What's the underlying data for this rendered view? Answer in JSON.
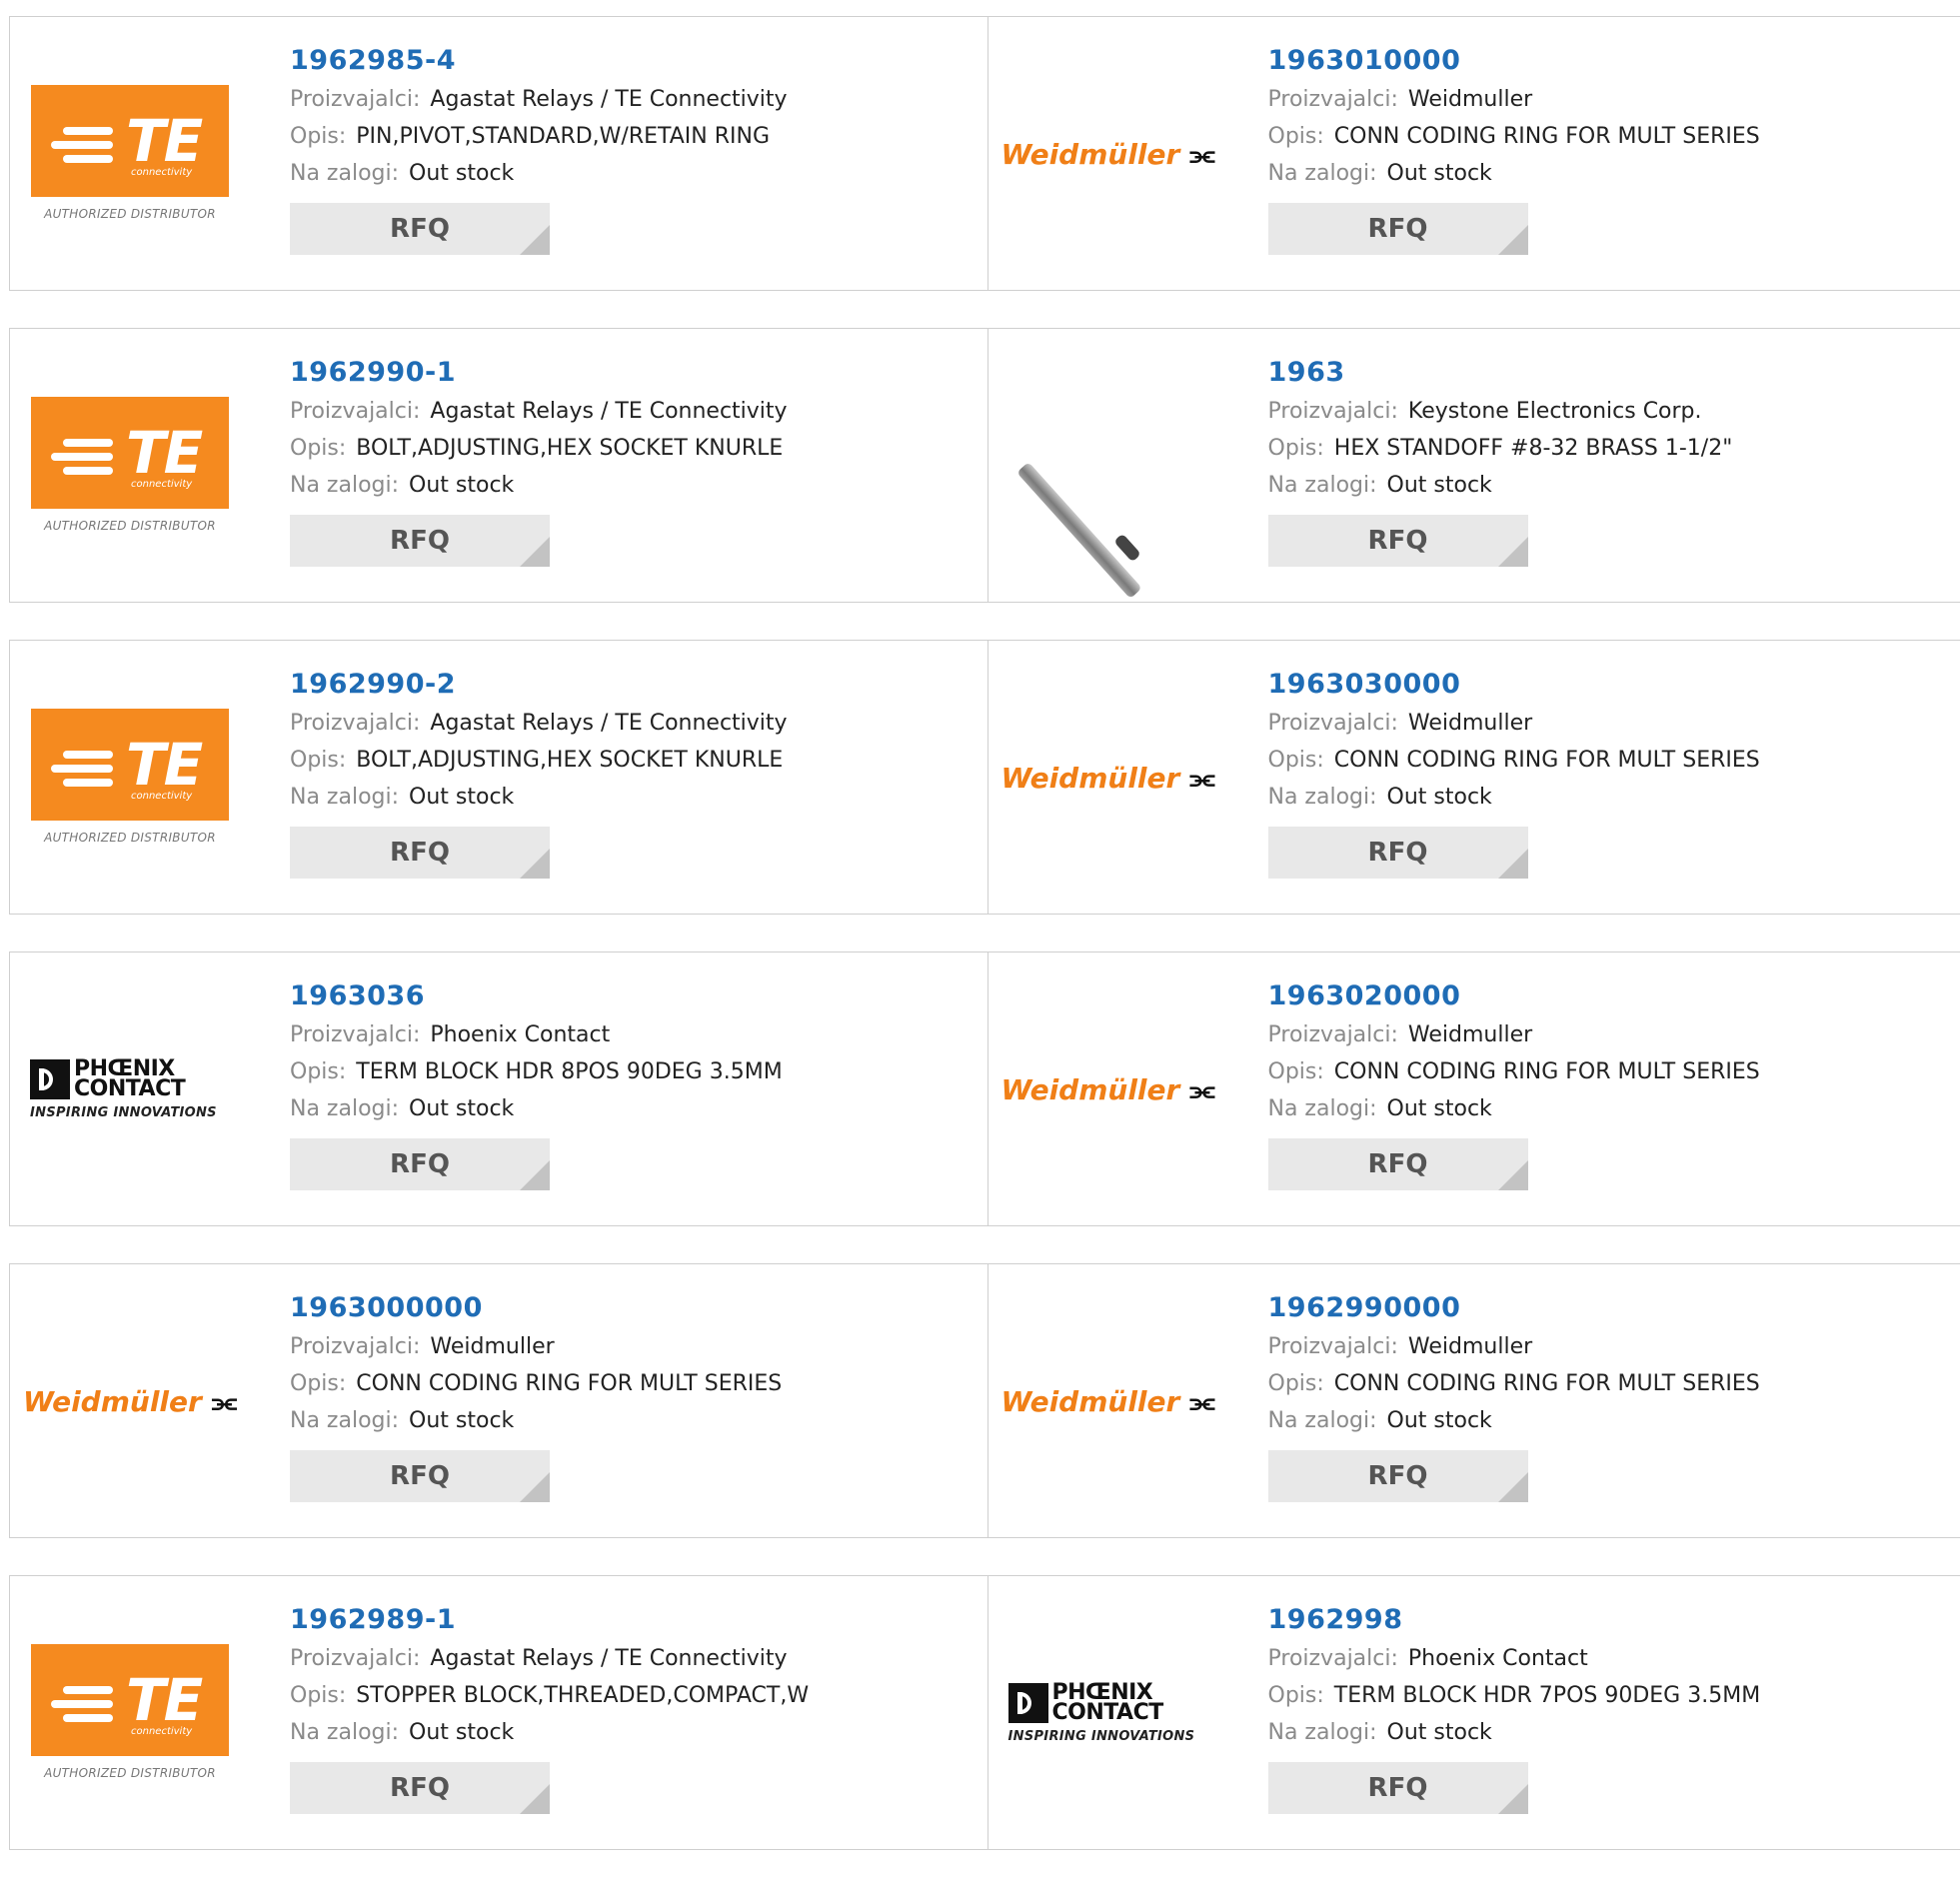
{
  "labels": {
    "manufacturer": "Proizvajalci:",
    "description": "Opis:",
    "stock": "Na zalogi:",
    "rfq": "RFQ"
  },
  "brand_text": {
    "te_word": "TE",
    "te_sub": "connectivity",
    "te_authorized": "AUTHORIZED DISTRIBUTOR",
    "weidmuller_word": "Weidmüller",
    "phoenix_line1": "PHŒNIX",
    "phoenix_line2": "CONTACT",
    "phoenix_tagline": "INSPIRING INNOVATIONS"
  },
  "colors": {
    "part_number_link": "#1f6cb5",
    "te_orange": "#f58a1f",
    "weidmuller_orange": "#f07f17",
    "rfq_button_bg": "#e8e8e8"
  },
  "products": [
    {
      "part": "1962985-4",
      "manufacturer": "Agastat Relays / TE Connectivity",
      "description": "PIN,PIVOT,STANDARD,W/RETAIN RING",
      "stock": "Out stock",
      "logo": "te"
    },
    {
      "part": "1963010000",
      "manufacturer": "Weidmuller",
      "description": "CONN CODING RING FOR MULT SERIES",
      "stock": "Out stock",
      "logo": "weidmuller"
    },
    {
      "part": "1962990-1",
      "manufacturer": "Agastat Relays / TE Connectivity",
      "description": "BOLT,ADJUSTING,HEX SOCKET KNURLE",
      "stock": "Out stock",
      "logo": "te"
    },
    {
      "part": "1963",
      "manufacturer": "Keystone Electronics Corp.",
      "description": "HEX STANDOFF #8-32 BRASS 1-1/2\"",
      "stock": "Out stock",
      "logo": "standoff-photo"
    },
    {
      "part": "1962990-2",
      "manufacturer": "Agastat Relays / TE Connectivity",
      "description": "BOLT,ADJUSTING,HEX SOCKET KNURLE",
      "stock": "Out stock",
      "logo": "te"
    },
    {
      "part": "1963030000",
      "manufacturer": "Weidmuller",
      "description": "CONN CODING RING FOR MULT SERIES",
      "stock": "Out stock",
      "logo": "weidmuller"
    },
    {
      "part": "1963036",
      "manufacturer": "Phoenix Contact",
      "description": "TERM BLOCK HDR 8POS 90DEG 3.5MM",
      "stock": "Out stock",
      "logo": "phoenix"
    },
    {
      "part": "1963020000",
      "manufacturer": "Weidmuller",
      "description": "CONN CODING RING FOR MULT SERIES",
      "stock": "Out stock",
      "logo": "weidmuller"
    },
    {
      "part": "1963000000",
      "manufacturer": "Weidmuller",
      "description": "CONN CODING RING FOR MULT SERIES",
      "stock": "Out stock",
      "logo": "weidmuller"
    },
    {
      "part": "1962990000",
      "manufacturer": "Weidmuller",
      "description": "CONN CODING RING FOR MULT SERIES",
      "stock": "Out stock",
      "logo": "weidmuller"
    },
    {
      "part": "1962989-1",
      "manufacturer": "Agastat Relays / TE Connectivity",
      "description": "STOPPER BLOCK,THREADED,COMPACT,W",
      "stock": "Out stock",
      "logo": "te"
    },
    {
      "part": "1962998",
      "manufacturer": "Phoenix Contact",
      "description": "TERM BLOCK HDR 7POS 90DEG 3.5MM",
      "stock": "Out stock",
      "logo": "phoenix"
    }
  ]
}
